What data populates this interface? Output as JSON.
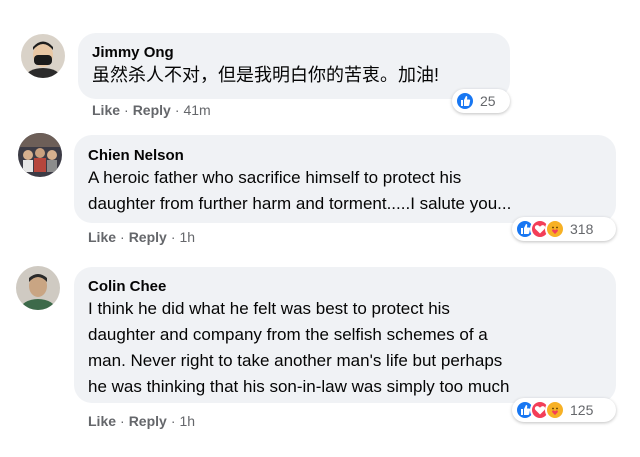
{
  "comments": [
    {
      "author": "Jimmy Ong",
      "lines": [
        "虽然杀人不对，但是我明白你的苦衷。加油!"
      ],
      "actions": {
        "like": "Like",
        "reply": "Reply",
        "time": "41m"
      },
      "reactions": {
        "icons": [
          "like-icon"
        ],
        "count": "25"
      }
    },
    {
      "author": "Chien Nelson",
      "lines": [
        "A heroic father who sacrifice himself to protect his",
        "daughter from further harm and torment.....I salute you..."
      ],
      "actions": {
        "like": "Like",
        "reply": "Reply",
        "time": "1h"
      },
      "reactions": {
        "icons": [
          "like-icon",
          "love-icon",
          "care-icon"
        ],
        "count": "318"
      }
    },
    {
      "author": "Colin Chee",
      "lines": [
        "I think he did what he felt was best to protect his",
        "daughter and company from the selfish schemes of a",
        "man. Never right to take another man's life but perhaps",
        "he was thinking that his son-in-law was simply too much"
      ],
      "actions": {
        "like": "Like",
        "reply": "Reply",
        "time": "1h"
      },
      "reactions": {
        "icons": [
          "like-icon",
          "love-icon",
          "care-icon"
        ],
        "count": "125"
      }
    }
  ],
  "colors": {
    "bubble": "#f0f2f5",
    "like": "#1877f2",
    "love": "#f33e58",
    "care": "#f7b125",
    "meta": "#65676b"
  }
}
